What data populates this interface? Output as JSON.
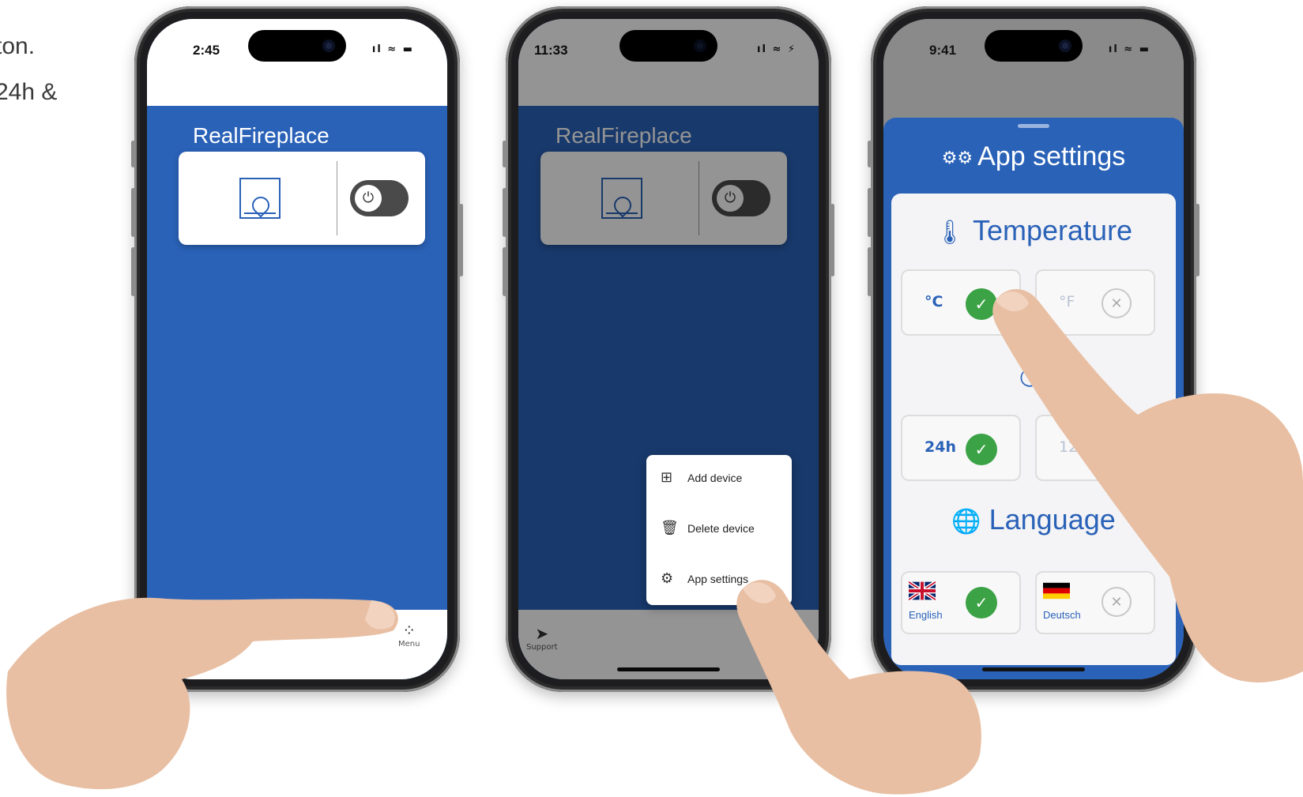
{
  "instructions": {
    "line1": "ton.",
    "line2": "24h &"
  },
  "phone1": {
    "time": "2:45",
    "status_icons": "ıl ≈ ▬",
    "app_title": "RealFireplace",
    "nav": {
      "support_label": "",
      "menu_label": "Menu"
    }
  },
  "phone2": {
    "time": "11:33",
    "status_icons": "ıl ≈ ⚡",
    "app_title": "RealFireplace",
    "menu": {
      "items": [
        {
          "label": "Add device",
          "icon": "plus-square-icon"
        },
        {
          "label": "Delete device",
          "icon": "trash-icon"
        },
        {
          "label": "App settings",
          "icon": "gear-icon"
        }
      ]
    },
    "nav": {
      "support_label": "Support"
    }
  },
  "phone3": {
    "time": "9:41",
    "status_icons": "ıl ≈ ▬",
    "sheet_title": "App settings",
    "temperature": {
      "title": "Temperature",
      "options": [
        {
          "label": "°C",
          "selected": true
        },
        {
          "label": "°F",
          "selected": false
        }
      ]
    },
    "time_format": {
      "options": [
        {
          "label": "24h",
          "selected": true
        },
        {
          "label": "12h",
          "selected": false
        }
      ]
    },
    "language": {
      "title": "Language",
      "options": [
        {
          "label": "English",
          "selected": true
        },
        {
          "label": "Deutsch",
          "selected": false
        }
      ]
    }
  },
  "colors": {
    "app_blue": "#2a62b8",
    "check_green": "#3ba245",
    "phone_frame": "#1d1d1f"
  }
}
